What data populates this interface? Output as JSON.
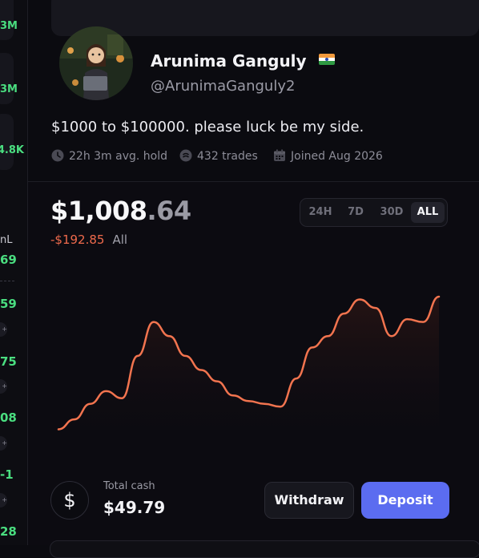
{
  "left_column": {
    "top_dot": "·",
    "values": [
      "3M",
      ".3M",
      "4.8K"
    ],
    "pnl_label": "nL",
    "pnl_rows": [
      "69",
      "59",
      "75",
      "08",
      "-1",
      "28"
    ],
    "chip_text": "+"
  },
  "profile": {
    "name": "Arunima Ganguly",
    "handle": "@ArunimaGanguly2",
    "bio": "$1000 to $100000. please luck be my side.",
    "stats": {
      "hold": "22h 3m avg. hold",
      "trades": "432 trades",
      "joined": "Joined Aug 2026"
    }
  },
  "portfolio": {
    "balance_main": "$1,008",
    "balance_cents": ".64",
    "change": "-$192.85",
    "period": "All",
    "timeframes": [
      "24H",
      "7D",
      "30D",
      "ALL"
    ],
    "active_timeframe": "ALL"
  },
  "chart_data": {
    "type": "area",
    "series": [
      {
        "values": [
          0.06,
          0.13,
          0.24,
          0.33,
          0.28,
          0.58,
          0.82,
          0.72,
          0.58,
          0.48,
          0.4,
          0.3,
          0.26,
          0.24,
          0.22,
          0.42,
          0.64,
          0.72,
          0.88,
          0.98,
          0.92,
          0.72,
          0.84,
          0.82,
          1.0
        ]
      }
    ]
  },
  "cash": {
    "symbol": "$",
    "label": "Total cash",
    "value": "$49.79"
  },
  "actions": {
    "withdraw": "Withdraw",
    "deposit": "Deposit"
  },
  "colors": {
    "accent": "#5b6cf0",
    "negative": "#ef6a4c",
    "positive": "#4ade80",
    "chart_line": "#f2744f"
  },
  "icons": {
    "hold": "clock-icon",
    "trades": "coins-icon",
    "joined": "calendar-icon",
    "flag": "india-flag-icon"
  }
}
